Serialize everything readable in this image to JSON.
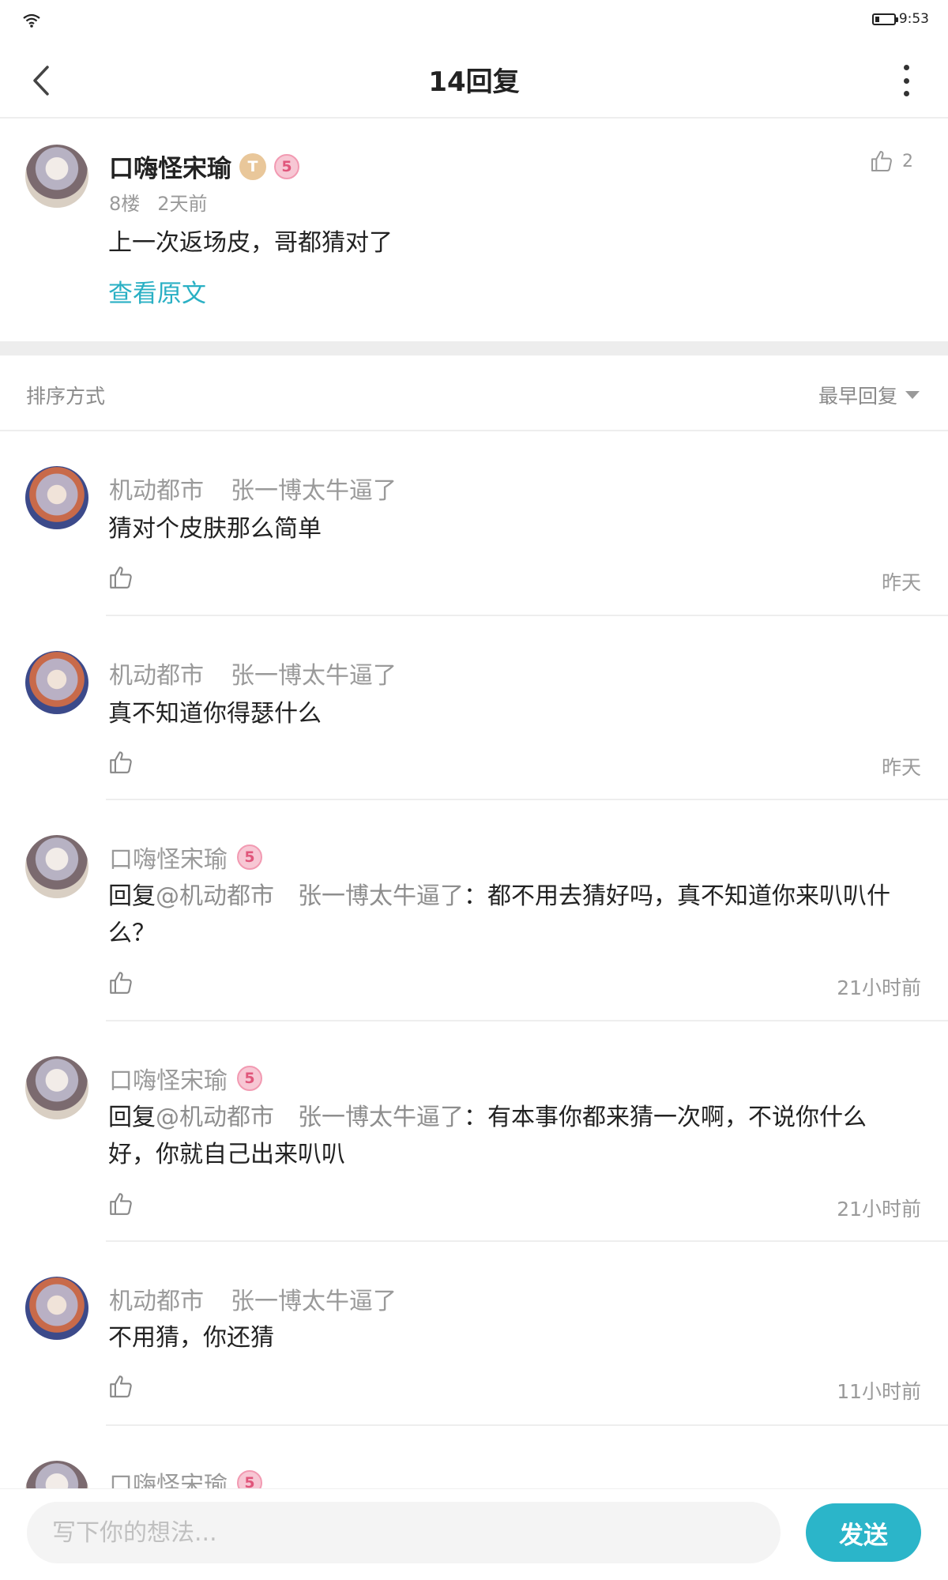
{
  "status_bar": {
    "time": "9:53"
  },
  "nav": {
    "title": "14回复"
  },
  "main_post": {
    "author": "口嗨怪宋瑜",
    "badge_t": "T",
    "badge_level": "5",
    "likes": "2",
    "floor": "8楼",
    "time": "2天前",
    "text": "上一次返场皮，哥都猜对了",
    "view_original": "查看原文"
  },
  "sort": {
    "label": "排序方式",
    "selected": "最早回复"
  },
  "comments": [
    {
      "author": "机动都市",
      "author_suffix": "张一博太牛逼了",
      "badge": "",
      "reply_prefix": "",
      "reply_target": "",
      "text": "猜对个皮肤那么简单",
      "time": "昨天"
    },
    {
      "author": "机动都市",
      "author_suffix": "张一博太牛逼了",
      "badge": "",
      "reply_prefix": "",
      "reply_target": "",
      "text": "真不知道你得瑟什么",
      "time": "昨天"
    },
    {
      "author": "口嗨怪宋瑜",
      "author_suffix": "",
      "badge": "5",
      "reply_prefix": "回复",
      "reply_target": "@机动都市　张一博太牛逼了",
      "text": "：都不用去猜好吗，真不知道你来叭叭什么？",
      "time": "21小时前"
    },
    {
      "author": "口嗨怪宋瑜",
      "author_suffix": "",
      "badge": "5",
      "reply_prefix": "回复",
      "reply_target": "@机动都市　张一博太牛逼了",
      "text": "：有本事你都来猜一次啊，不说你什么好，你就自己出来叭叭",
      "time": "21小时前"
    },
    {
      "author": "机动都市",
      "author_suffix": "张一博太牛逼了",
      "badge": "",
      "reply_prefix": "",
      "reply_target": "",
      "text": "不用猜，你还猜",
      "time": "11小时前"
    },
    {
      "author": "口嗨怪宋瑜",
      "author_suffix": "",
      "badge": "5",
      "reply_prefix": "",
      "reply_target": "",
      "text": "",
      "time": ""
    }
  ],
  "input": {
    "placeholder": "写下你的想法...",
    "send_label": "发送"
  },
  "colors": {
    "accent": "#2bb5c9",
    "link": "#2ab0c4",
    "muted": "#9a9a9a"
  },
  "icons": [
    "wifi-icon",
    "battery-icon",
    "back-arrow-icon",
    "more-vertical-icon",
    "thumbs-up-icon",
    "caret-down-icon",
    "avatar"
  ]
}
